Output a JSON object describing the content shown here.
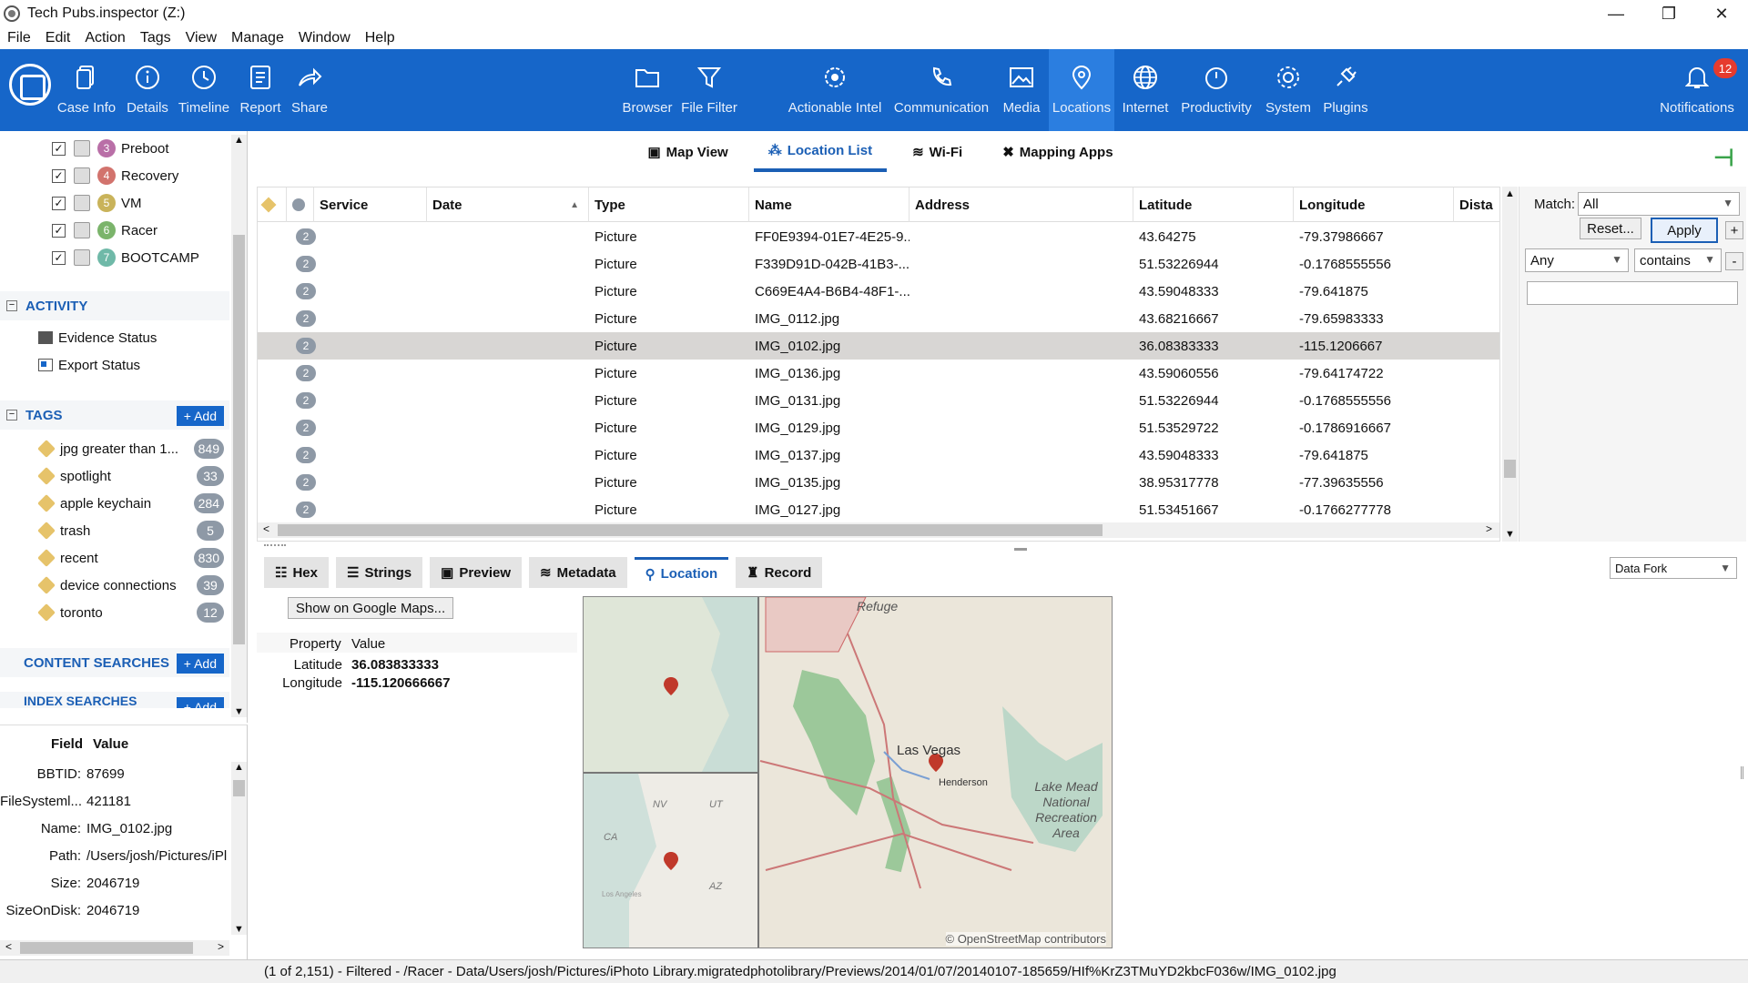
{
  "window": {
    "title": "Tech Pubs.inspector (Z:)",
    "minimize": "—",
    "maximize": "❐",
    "close": "✕"
  },
  "menu": [
    "File",
    "Edit",
    "Action",
    "Tags",
    "View",
    "Manage",
    "Window",
    "Help"
  ],
  "ribbon": {
    "left": [
      {
        "label": "Case Info",
        "icon": "case-info-icon"
      },
      {
        "label": "Details",
        "icon": "info-icon"
      },
      {
        "label": "Timeline",
        "icon": "timeline-icon"
      },
      {
        "label": "Report",
        "icon": "report-icon"
      },
      {
        "label": "Share",
        "icon": "share-icon"
      }
    ],
    "center": [
      {
        "label": "Browser",
        "icon": "folder-icon"
      },
      {
        "label": "File Filter",
        "icon": "filter-icon"
      },
      {
        "label": "Actionable Intel",
        "icon": "intel-icon"
      },
      {
        "label": "Communication",
        "icon": "phone-icon"
      },
      {
        "label": "Media",
        "icon": "image-icon"
      },
      {
        "label": "Locations",
        "icon": "pin-icon"
      },
      {
        "label": "Internet",
        "icon": "globe-icon"
      },
      {
        "label": "Productivity",
        "icon": "productivity-icon"
      },
      {
        "label": "System",
        "icon": "gear-icon"
      },
      {
        "label": "Plugins",
        "icon": "plugin-icon"
      }
    ],
    "notifications": {
      "label": "Notifications",
      "count": "12"
    },
    "accent": "#1666c9"
  },
  "evidence": [
    {
      "num": "3",
      "label": "Preboot",
      "color": "#b96fa7"
    },
    {
      "num": "4",
      "label": "Recovery",
      "color": "#d2736d"
    },
    {
      "num": "5",
      "label": "VM",
      "color": "#c9b35a"
    },
    {
      "num": "6",
      "label": "Racer",
      "color": "#7bb46b"
    },
    {
      "num": "7",
      "label": "BOOTCAMP",
      "color": "#6fb9a8"
    }
  ],
  "activity": {
    "header": "ACTIVITY",
    "items": [
      "Evidence Status",
      "Export Status"
    ]
  },
  "tags": {
    "header": "TAGS",
    "add": "+ Add",
    "items": [
      {
        "label": "jpg greater than 1...",
        "count": "849"
      },
      {
        "label": "spotlight",
        "count": "33"
      },
      {
        "label": "apple keychain",
        "count": "284"
      },
      {
        "label": "trash",
        "count": "5"
      },
      {
        "label": "recent",
        "count": "830"
      },
      {
        "label": "device connections",
        "count": "39"
      },
      {
        "label": "toronto",
        "count": "12"
      }
    ]
  },
  "content_searches": {
    "header": "CONTENT SEARCHES",
    "add": "+ Add"
  },
  "index_searches": {
    "header": "INDEX SEARCHES",
    "add": "+ Add"
  },
  "field_table": {
    "field": "Field",
    "value": "Value",
    "rows": [
      {
        "f": "BBTID:",
        "v": "87699"
      },
      {
        "f": "FileSysteml...",
        "v": "421181"
      },
      {
        "f": "Name:",
        "v": "IMG_0102.jpg"
      },
      {
        "f": "Path:",
        "v": "/Users/josh/Pictures/iPl"
      },
      {
        "f": "Size:",
        "v": "2046719"
      },
      {
        "f": "SizeOnDisk:",
        "v": "2046719"
      }
    ]
  },
  "subtabs": [
    "Map View",
    "Location List",
    "Wi-Fi",
    "Mapping Apps"
  ],
  "table": {
    "columns": [
      "Service",
      "Date",
      "Type",
      "Name",
      "Address",
      "Latitude",
      "Longitude",
      "Dista"
    ],
    "rows": [
      {
        "n": "2",
        "type": "Picture",
        "name": "FF0E9394-01E7-4E25-9...",
        "lat": "43.64275",
        "lon": "-79.37986667"
      },
      {
        "n": "2",
        "type": "Picture",
        "name": "F339D91D-042B-41B3-...",
        "lat": "51.53226944",
        "lon": "-0.1768555556"
      },
      {
        "n": "2",
        "type": "Picture",
        "name": "C669E4A4-B6B4-48F1-...",
        "lat": "43.59048333",
        "lon": "-79.641875"
      },
      {
        "n": "2",
        "type": "Picture",
        "name": "IMG_0112.jpg",
        "lat": "43.68216667",
        "lon": "-79.65983333"
      },
      {
        "n": "2",
        "type": "Picture",
        "name": "IMG_0102.jpg",
        "lat": "36.08383333",
        "lon": "-115.1206667"
      },
      {
        "n": "2",
        "type": "Picture",
        "name": "IMG_0136.jpg",
        "lat": "43.59060556",
        "lon": "-79.64174722"
      },
      {
        "n": "2",
        "type": "Picture",
        "name": "IMG_0131.jpg",
        "lat": "51.53226944",
        "lon": "-0.1768555556"
      },
      {
        "n": "2",
        "type": "Picture",
        "name": "IMG_0129.jpg",
        "lat": "51.53529722",
        "lon": "-0.1786916667"
      },
      {
        "n": "2",
        "type": "Picture",
        "name": "IMG_0137.jpg",
        "lat": "43.59048333",
        "lon": "-79.641875"
      },
      {
        "n": "2",
        "type": "Picture",
        "name": "IMG_0135.jpg",
        "lat": "38.95317778",
        "lon": "-77.39635556"
      },
      {
        "n": "2",
        "type": "Picture",
        "name": "IMG_0127.jpg",
        "lat": "51.53451667",
        "lon": "-0.1766277778"
      }
    ]
  },
  "filter": {
    "match_label": "Match:",
    "match_value": "All",
    "reset": "Reset...",
    "apply": "Apply",
    "plus": "+",
    "minus": "-",
    "any": "Any",
    "contains": "contains",
    "text": ""
  },
  "bottom_tabs": [
    "Hex",
    "Strings",
    "Preview",
    "Metadata",
    "Location",
    "Record"
  ],
  "data_fork": "Data Fork",
  "location_detail": {
    "google_btn": "Show on Google Maps...",
    "prop_header": "Property",
    "val_header": "Value",
    "lat_label": "Latitude",
    "lat_value": "36.083833333",
    "lon_label": "Longitude",
    "lon_value": "-115.120666667"
  },
  "map": {
    "refuge": "Refuge",
    "city": "Las Vegas",
    "henderson": "Henderson",
    "lake": "Lake Mead National Recreation Area",
    "credit": "© OpenStreetMap contributors",
    "nv": "NV",
    "ut": "UT",
    "ca": "CA",
    "az": "AZ",
    "la": "Los Angeles"
  },
  "status": "(1 of 2,151) - Filtered  -  /Racer - Data/Users/josh/Pictures/iPhoto Library.migratedphotolibrary/Previews/2014/01/07/20140107-185659/HIf%KrZ3TMuYD2kbcF036w/IMG_0102.jpg"
}
